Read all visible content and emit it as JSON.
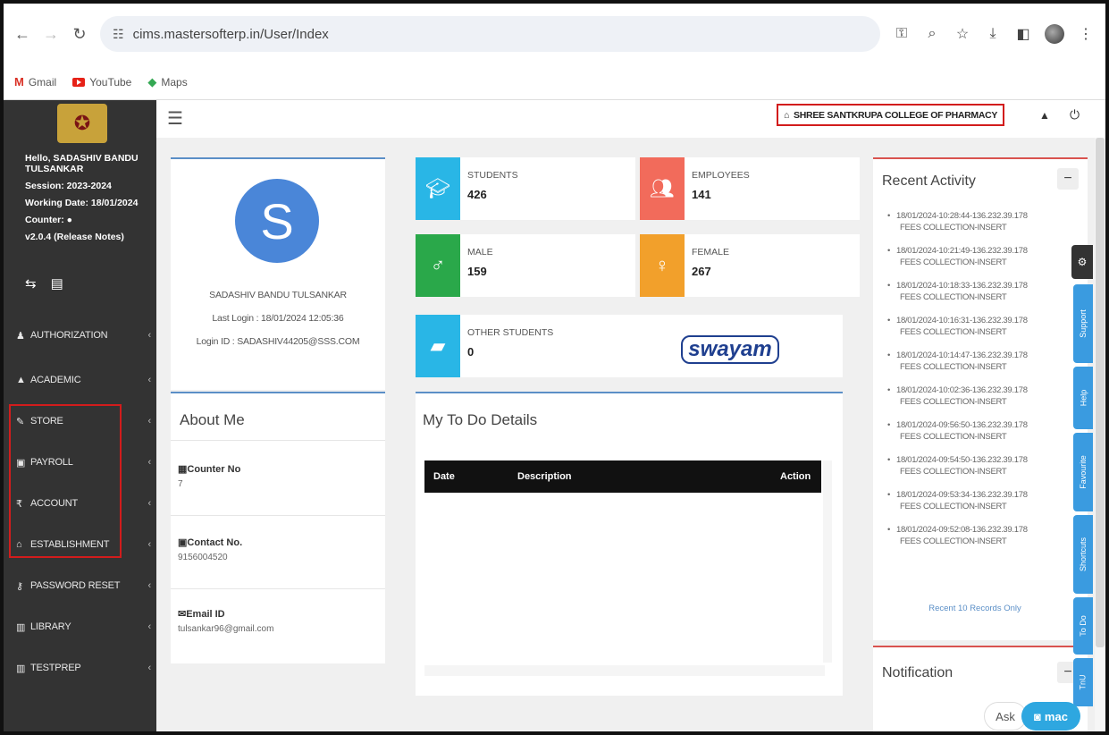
{
  "browser": {
    "url": "cims.mastersofterp.in/User/Index",
    "bookmarks": [
      {
        "label": "Gmail"
      },
      {
        "label": "YouTube"
      },
      {
        "label": "Maps"
      }
    ]
  },
  "sidebar": {
    "greeting_1": "Hello, SADASHIV BANDU",
    "greeting_2": "TULSANKAR",
    "session": "Session: 2023-2024",
    "working_date": "Working Date: 18/01/2024",
    "counter": "Counter:",
    "version": "v2.0.4 (Release Notes)",
    "menu": [
      {
        "label": "AUTHORIZATION",
        "icon": "user-lock-icon"
      },
      {
        "label": "ACADEMIC",
        "icon": "graduation-cap-icon"
      },
      {
        "label": "STORE",
        "icon": "tag-icon"
      },
      {
        "label": "PAYROLL",
        "icon": "money-icon"
      },
      {
        "label": "ACCOUNT",
        "icon": "rupee-icon"
      },
      {
        "label": "ESTABLISHMENT",
        "icon": "bank-icon"
      },
      {
        "label": "PASSWORD RESET",
        "icon": "key-icon"
      },
      {
        "label": "LIBRARY",
        "icon": "book-icon"
      },
      {
        "label": "TESTPREP",
        "icon": "book-icon"
      }
    ]
  },
  "header": {
    "college": "SHREE SANTKRUPA COLLEGE OF PHARMACY"
  },
  "profile": {
    "initial": "S",
    "name": "SADASHIV BANDU TULSANKAR",
    "last_login": "Last Login : 18/01/2024 12:05:36",
    "login_id": "Login ID : SADASHIV44205@SSS.COM"
  },
  "about": {
    "title": "About Me",
    "counter_label": "Counter No",
    "counter_value": "7",
    "contact_label": "Contact No.",
    "contact_value": "9156004520",
    "email_label": "Email ID",
    "email_value": "tulsankar96@gmail.com"
  },
  "stats": {
    "students": {
      "label": "STUDENTS",
      "value": "426",
      "color": "#29b6e6"
    },
    "employees": {
      "label": "EMPLOYEES",
      "value": "141",
      "color": "#f26b5b"
    },
    "male": {
      "label": "MALE",
      "value": "159",
      "color": "#2aa84a"
    },
    "female": {
      "label": "FEMALE",
      "value": "267",
      "color": "#f2a02b"
    },
    "other": {
      "label": "OTHER STUDENTS",
      "value": "0",
      "color": "#29b6e6"
    }
  },
  "swayam": {
    "label": "swayam"
  },
  "todo": {
    "title": "My To Do Details",
    "col_date": "Date",
    "col_desc": "Description",
    "col_action": "Action"
  },
  "recent": {
    "title": "Recent Activity",
    "items": [
      {
        "time": "18/01/2024-10:28:44-136.232.39.178",
        "desc": "FEES COLLECTION-INSERT"
      },
      {
        "time": "18/01/2024-10:21:49-136.232.39.178",
        "desc": "FEES COLLECTION-INSERT"
      },
      {
        "time": "18/01/2024-10:18:33-136.232.39.178",
        "desc": "FEES COLLECTION-INSERT"
      },
      {
        "time": "18/01/2024-10:16:31-136.232.39.178",
        "desc": "FEES COLLECTION-INSERT"
      },
      {
        "time": "18/01/2024-10:14:47-136.232.39.178",
        "desc": "FEES COLLECTION-INSERT"
      },
      {
        "time": "18/01/2024-10:02:36-136.232.39.178",
        "desc": "FEES COLLECTION-INSERT"
      },
      {
        "time": "18/01/2024-09:56:50-136.232.39.178",
        "desc": "FEES COLLECTION-INSERT"
      },
      {
        "time": "18/01/2024-09:54:50-136.232.39.178",
        "desc": "FEES COLLECTION-INSERT"
      },
      {
        "time": "18/01/2024-09:53:34-136.232.39.178",
        "desc": "FEES COLLECTION-INSERT"
      },
      {
        "time": "18/01/2024-09:52:08-136.232.39.178",
        "desc": "FEES COLLECTION-INSERT"
      }
    ],
    "footer": "Recent 10 Records Only"
  },
  "notification": {
    "title": "Notification"
  },
  "side_tabs": [
    "Support",
    "Help",
    "Favourite",
    "Shortcuts",
    "To Do",
    "TnU"
  ],
  "chat": {
    "ask": "Ask",
    "mac": "mac"
  }
}
